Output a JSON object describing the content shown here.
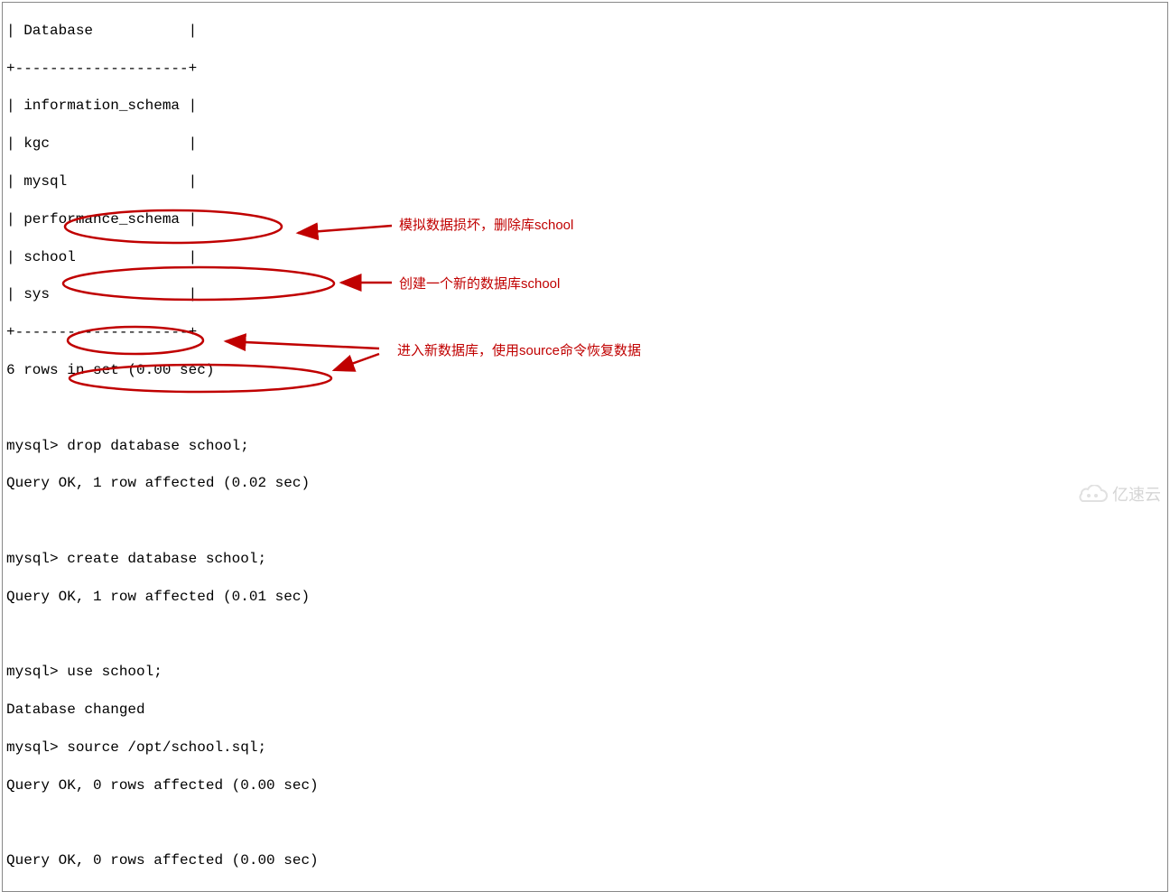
{
  "terminal": {
    "lines": [
      "| Database           |",
      "+--------------------+",
      "| information_schema |",
      "| kgc                |",
      "| mysql              |",
      "| performance_schema |",
      "| school             |",
      "| sys                |",
      "+--------------------+",
      "6 rows in set (0.00 sec)",
      "",
      "mysql> drop database school;",
      "Query OK, 1 row affected (0.02 sec)",
      "",
      "mysql> create database school;",
      "Query OK, 1 row affected (0.01 sec)",
      "",
      "mysql> use school;",
      "Database changed",
      "mysql> source /opt/school.sql;",
      "Query OK, 0 rows affected (0.00 sec)",
      "",
      "Query OK, 0 rows affected (0.00 sec)"
    ]
  },
  "annotations": {
    "a1": "模拟数据损坏，删除库school",
    "a2": "创建一个新的数据库school",
    "a3": "进入新数据库，使用source命令恢复数据"
  },
  "watermark": {
    "text": "亿速云"
  }
}
